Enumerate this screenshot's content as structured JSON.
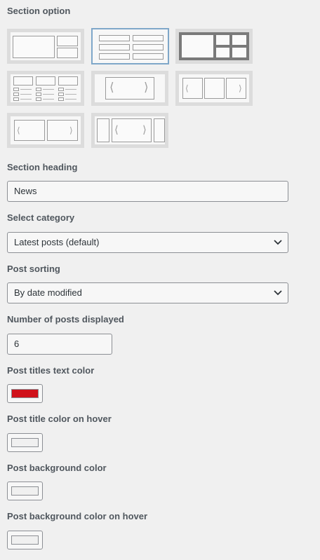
{
  "section_option": {
    "label": "Section option",
    "layouts": [
      {
        "name": "big-left-two-right",
        "selected": false
      },
      {
        "name": "two-column-list",
        "selected": true
      },
      {
        "name": "grid-dark",
        "selected": false
      },
      {
        "name": "three-column-thumbs",
        "selected": false
      },
      {
        "name": "single-slider",
        "selected": false
      },
      {
        "name": "triple-slider",
        "selected": false
      },
      {
        "name": "double-slider",
        "selected": false
      },
      {
        "name": "carousel-with-sides",
        "selected": false
      }
    ]
  },
  "section_heading": {
    "label": "Section heading",
    "value": "News"
  },
  "select_category": {
    "label": "Select category",
    "value": "Latest posts (default)"
  },
  "post_sorting": {
    "label": "Post sorting",
    "value": "By date modified"
  },
  "posts_displayed": {
    "label": "Number of posts displayed",
    "value": "6"
  },
  "title_text_color": {
    "label": "Post titles text color",
    "color": "#d0121b"
  },
  "title_hover_color": {
    "label": "Post title color on hover",
    "color": "#f0f0f0"
  },
  "bg_color": {
    "label": "Post background color",
    "color": "#f0f0f0"
  },
  "bg_hover_color": {
    "label": "Post background color on hover",
    "color": "#f0f0f0"
  },
  "icons": {
    "chevron": "chevron-down-icon"
  }
}
